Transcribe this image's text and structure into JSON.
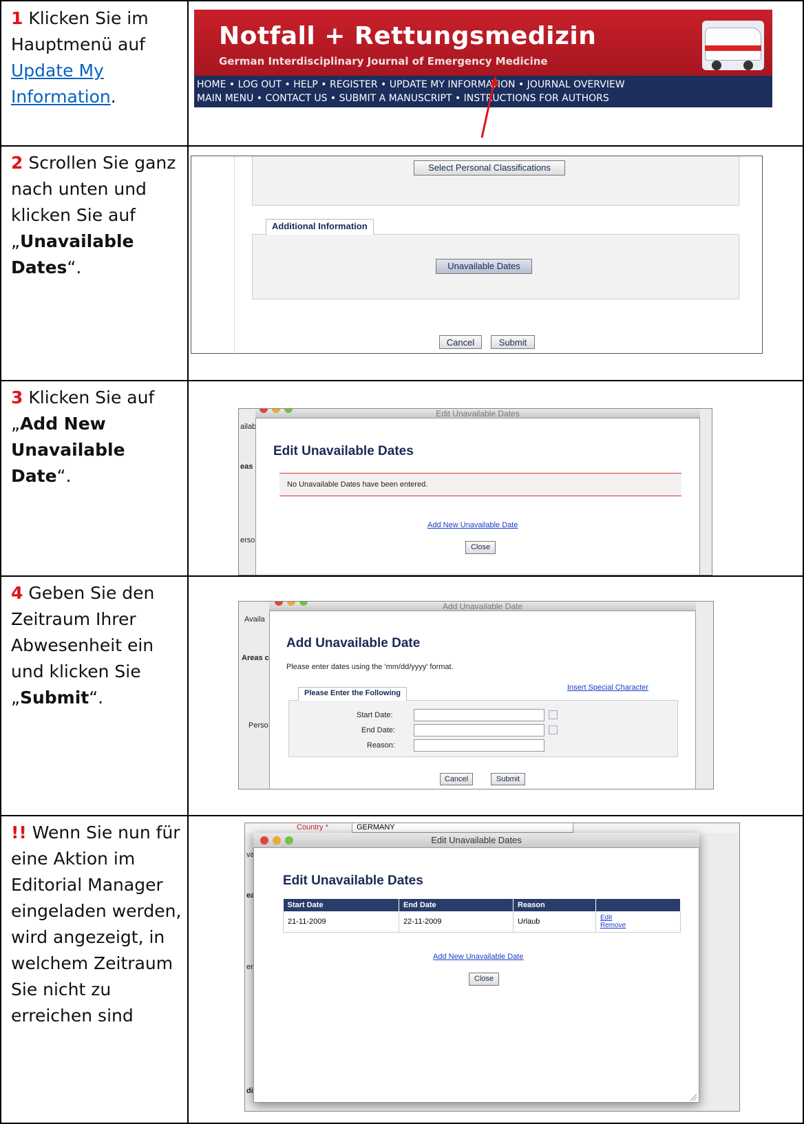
{
  "steps": [
    {
      "num": "1",
      "text_before": " Klicken Sie im Hauptmenü auf ",
      "link": "Update My Information",
      "text_after": "."
    },
    {
      "num": "2",
      "text_before": " Scrollen Sie ganz nach unten und klicken Sie auf „",
      "bold": "Unavailable Dates",
      "text_after": "“."
    },
    {
      "num": "3",
      "text_before": " Klicken Sie auf „",
      "bold": "Add New Unavailable Date",
      "text_after": "“."
    },
    {
      "num": "4",
      "text_before": " Geben Sie den Zeitraum Ihrer Abwesenheit ein und klicken Sie „",
      "bold": "Submit",
      "text_after": "“."
    },
    {
      "num": "!!",
      "text_before": " Wenn Sie nun für eine Aktion im Editorial Manager eingeladen werden, wird angezeigt, in welchem Zeitraum Sie nicht zu erreichen sind",
      "bold": "",
      "text_after": ""
    }
  ],
  "shot1": {
    "title": "Notfall + Rettungsmedizin",
    "subtitle": "German Interdisciplinary Journal of Emergency Medicine",
    "nav_line1": "HOME • LOG OUT • HELP • REGISTER • UPDATE MY INFORMATION • JOURNAL OVERVIEW",
    "nav_line2": "MAIN MENU • CONTACT US • SUBMIT A MANUSCRIPT • INSTRUCTIONS FOR AUTHORS"
  },
  "shot2": {
    "select_btn": "Select Personal Classifications",
    "tab": "Additional Information",
    "unavail_btn": "Unavailable Dates",
    "cancel": "Cancel",
    "submit": "Submit"
  },
  "shot3": {
    "window_title": "Edit Unavailable Dates",
    "heading": "Edit Unavailable Dates",
    "empty_msg": "No Unavailable Dates have been entered.",
    "add_link": "Add New Unavailable Date",
    "close": "Close",
    "side1": "ailab",
    "side2": "eas c",
    "side3": "erso"
  },
  "shot4": {
    "window_title": "Add Unavailable Date",
    "heading": "Add Unavailable Date",
    "instruction": "Please enter dates using the 'mm/dd/yyyy' format.",
    "special_link": "Insert Special Character",
    "tab": "Please Enter the Following",
    "start_label": "Start Date:",
    "end_label": "End Date:",
    "reason_label": "Reason:",
    "cancel": "Cancel",
    "submit": "Submit",
    "side1": "Availa",
    "side2": "Areas c",
    "side3": "Perso"
  },
  "shot5": {
    "country_label": "Country",
    "country_req": "*",
    "country_value": "GERMANY",
    "window_title": "Edit Unavailable Dates",
    "heading": "Edit Unavailable Dates",
    "columns": [
      "Start Date",
      "End Date",
      "Reason",
      ""
    ],
    "row": {
      "start": "21-11-2009",
      "end": "22-11-2009",
      "reason": "Urlaub",
      "edit": "Edit",
      "remove": "Remove"
    },
    "add_link": "Add New Unavailable Date",
    "close": "Close",
    "side1": "vailab",
    "side2": "eas c",
    "side3": "erso",
    "side4": "ditic"
  },
  "colors": {
    "step_number": "#e1131b",
    "link": "#0563c1",
    "banner_red": "#c8202a",
    "nav_blue": "#1c2e5c"
  }
}
